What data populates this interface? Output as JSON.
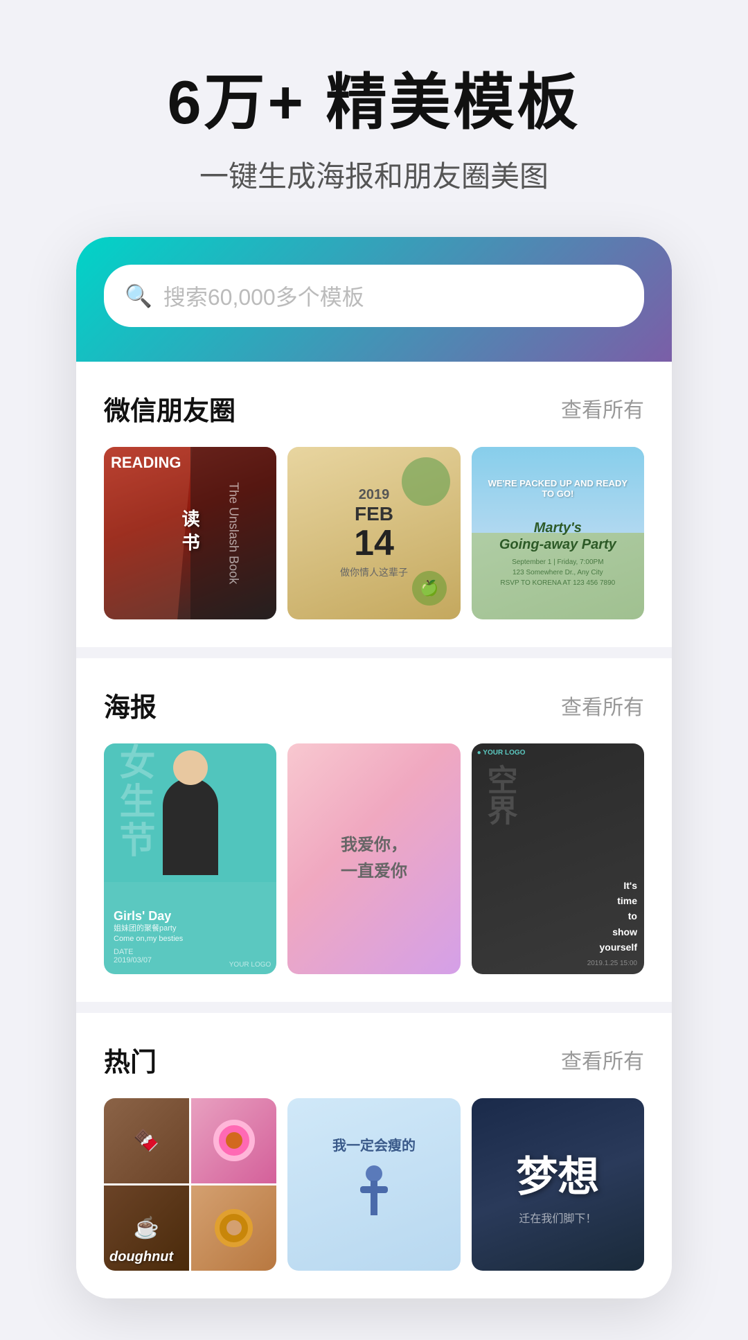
{
  "hero": {
    "title": "6万+ 精美模板",
    "subtitle": "一键生成海报和朋友圈美图"
  },
  "search": {
    "placeholder": "搜索60,000多个模板"
  },
  "sections": [
    {
      "id": "wechat",
      "title": "微信朋友圈",
      "more": "查看所有",
      "cards": [
        {
          "type": "reading",
          "label": "读书"
        },
        {
          "type": "feb14",
          "label": "2019 FEB 14"
        },
        {
          "type": "party",
          "label": "Marty's Going-away Party"
        }
      ]
    },
    {
      "id": "poster",
      "title": "海报",
      "more": "查看所有",
      "cards": [
        {
          "type": "girlsday",
          "label": "Girls' Day"
        },
        {
          "type": "love",
          "label": "我爱你，一直爱你"
        },
        {
          "type": "space",
          "label": "空界"
        }
      ]
    },
    {
      "id": "hot",
      "title": "热门",
      "more": "查看所有",
      "cards": [
        {
          "type": "doughnut",
          "label": "doughnut"
        },
        {
          "type": "motivation",
          "label": "我一定会瘦的"
        },
        {
          "type": "dream",
          "label": "梦想"
        }
      ]
    }
  ]
}
